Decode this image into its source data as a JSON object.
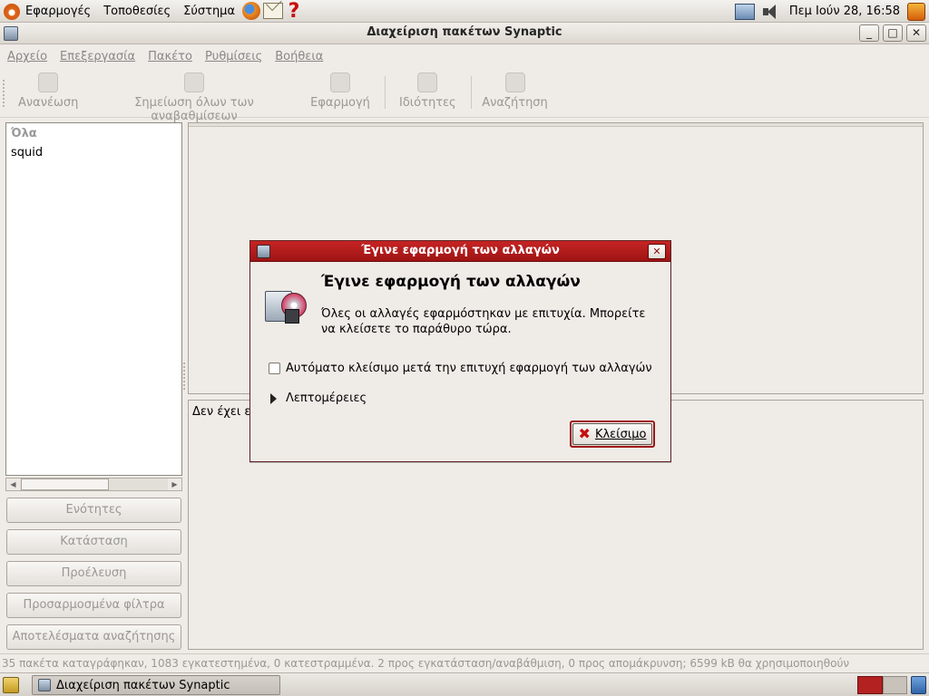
{
  "top_panel": {
    "menus": [
      "Εφαρμογές",
      "Τοποθεσίες",
      "Σύστημα"
    ],
    "clock": "Πεμ Ιούν 28, 16:58",
    "icons": [
      "ubuntu-foot-icon",
      "firefox-icon",
      "mail-icon",
      "help-icon",
      "network-icon",
      "volume-icon",
      "update-notifier-icon"
    ]
  },
  "window": {
    "title": "Διαχείριση πακέτων Synaptic",
    "menus": [
      "Αρχείο",
      "Επεξεργασία",
      "Πακέτο",
      "Ρυθμίσεις",
      "Βοήθεια"
    ],
    "toolbar": {
      "reload": "Ανανέωση",
      "mark_all": "Σημείωση όλων των αναβαθμίσεων",
      "apply": "Εφαρμογή",
      "properties": "Ιδιότητες",
      "search": "Αναζήτηση"
    },
    "filters": [
      "Όλα",
      "squid"
    ],
    "side_buttons": [
      "Ενότητες",
      "Κατάσταση",
      "Προέλευση",
      "Προσαρμοσμένα φίλτρα",
      "Αποτελέσματα αναζήτησης"
    ],
    "description_text": "Δεν έχει ε",
    "status": "35 πακέτα καταγράφηκαν, 1083 εγκατεστημένα, 0 κατεστραμμένα. 2 προς εγκατάσταση/αναβάθμιση, 0 προς απομάκρυνση; 6599 kB θα χρησιμοποιηθούν"
  },
  "dialog": {
    "title": "Έγινε εφαρμογή των αλλαγών",
    "heading": "Έγινε εφαρμογή των αλλαγών",
    "body": "Όλες οι αλλαγές εφαρμόστηκαν με επιτυχία. Μπορείτε να κλείσετε το παράθυρο τώρα.",
    "checkbox_label": "Αυτόματο κλείσιμο μετά την επιτυχή εφαρμογή των αλλαγών",
    "checkbox_checked": false,
    "details_label": "Λεπτομέρειες",
    "close_button": "Κλείσιμο"
  },
  "taskbar": {
    "task_label": "Διαχείριση πακέτων Synaptic"
  },
  "colors": {
    "dialog_titlebar": "#b01b1b",
    "panel_bg": "#efebe7"
  }
}
